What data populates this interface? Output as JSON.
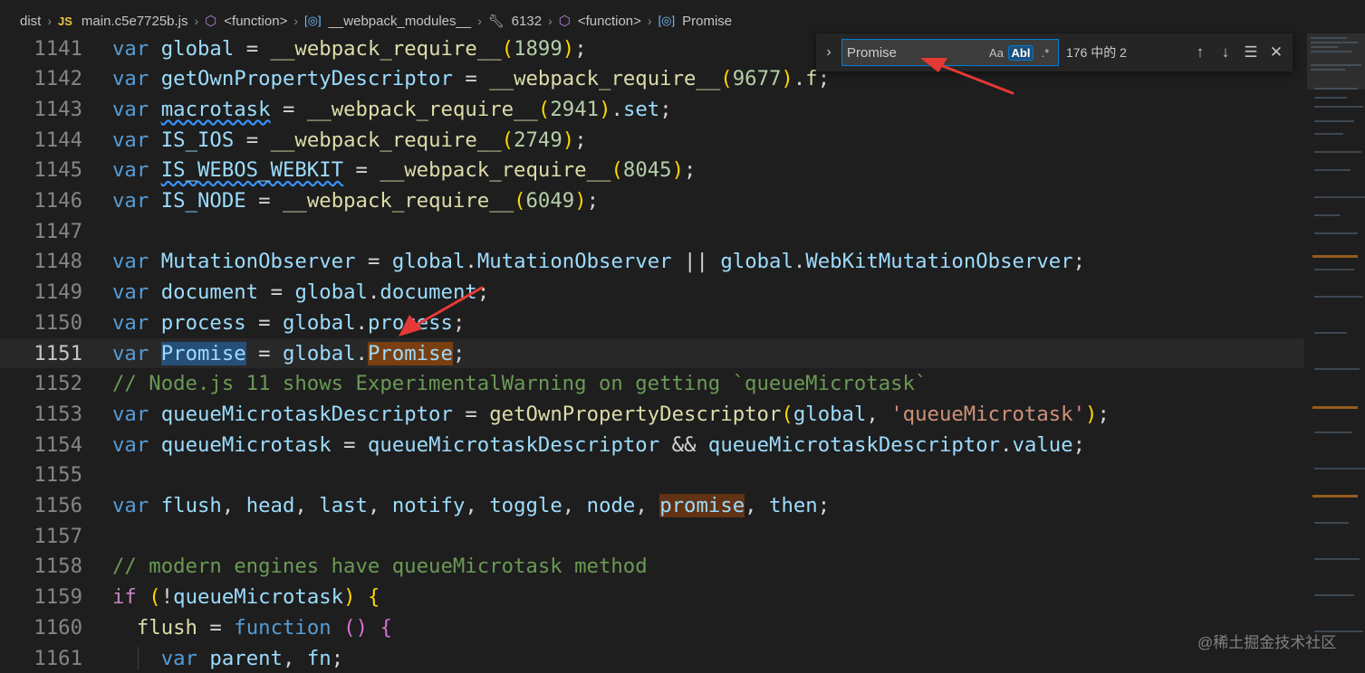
{
  "breadcrumb": {
    "items": [
      "dist",
      "main.c5e7725b.js",
      "<function>",
      "__webpack_modules__",
      "6132",
      "<function>",
      "Promise"
    ],
    "file_badge": "JS"
  },
  "find_widget": {
    "value": "Promise",
    "match_case_label": "Aa",
    "whole_word_label": "Abl",
    "regex_label": ".*",
    "result_count": "176 中的 2"
  },
  "editor": {
    "current_line": 1151,
    "lines": [
      {
        "n": "1141"
      },
      {
        "n": "1142"
      },
      {
        "n": "1143"
      },
      {
        "n": "1144"
      },
      {
        "n": "1145"
      },
      {
        "n": "1146"
      },
      {
        "n": "1147"
      },
      {
        "n": "1148"
      },
      {
        "n": "1149"
      },
      {
        "n": "1150"
      },
      {
        "n": "1151"
      },
      {
        "n": "1152"
      },
      {
        "n": "1153"
      },
      {
        "n": "1154"
      },
      {
        "n": "1155"
      },
      {
        "n": "1156"
      },
      {
        "n": "1157"
      },
      {
        "n": "1158"
      },
      {
        "n": "1159"
      },
      {
        "n": "1160"
      },
      {
        "n": "1161"
      }
    ],
    "code": {
      "kw_var": "var",
      "kw_if": "if",
      "kw_function": "function",
      "l1141": {
        "id": "global",
        "fn": "__webpack_require__",
        "num": "1899"
      },
      "l1142": {
        "id": "getOwnPropertyDescriptor",
        "fn": "__webpack_require__",
        "num": "9677",
        "prop": "f"
      },
      "l1143": {
        "id": "macrotask",
        "fn": "__webpack_require__",
        "num": "2941",
        "prop": "set"
      },
      "l1144": {
        "id": "IS_IOS",
        "fn": "__webpack_require__",
        "num": "2749"
      },
      "l1145": {
        "id": "IS_WEBOS_WEBKIT",
        "fn": "__webpack_require__",
        "num": "8045"
      },
      "l1146": {
        "id": "IS_NODE",
        "fn": "__webpack_require__",
        "num": "6049"
      },
      "l1148": {
        "id": "MutationObserver",
        "obj": "global",
        "p1": "MutationObserver",
        "p2": "WebKitMutationObserver"
      },
      "l1149": {
        "id": "document",
        "obj": "global",
        "prop": "document"
      },
      "l1150": {
        "id": "process",
        "obj": "global",
        "prop": "process"
      },
      "l1151": {
        "id": "Promise",
        "obj": "global",
        "prop": "Promise"
      },
      "l1152": {
        "comment": "// Node.js 11 shows ExperimentalWarning on getting `queueMicrotask`"
      },
      "l1153": {
        "id": "queueMicrotaskDescriptor",
        "fn": "getOwnPropertyDescriptor",
        "arg": "global",
        "str": "'queueMicrotask'"
      },
      "l1154": {
        "id": "queueMicrotask",
        "a": "queueMicrotaskDescriptor",
        "b": "queueMicrotaskDescriptor",
        "prop": "value"
      },
      "l1156": {
        "ids": [
          "flush",
          "head",
          "last",
          "notify",
          "toggle",
          "node"
        ],
        "match": "promise",
        "last": "then"
      },
      "l1158": {
        "comment": "// modern engines have queueMicrotask method"
      },
      "l1159": {
        "id": "queueMicrotask"
      },
      "l1160": {
        "id": "flush"
      },
      "l1161": {
        "a": "parent",
        "b": "fn"
      }
    }
  },
  "watermark": "@稀土掘金技术社区",
  "colors": {
    "background": "#1e1e1e",
    "keyword": "#569cd6",
    "variable": "#9cdcfe",
    "function": "#dcdcaa",
    "number": "#b5cea8",
    "string": "#ce9178",
    "comment": "#6a9955",
    "current_match": "#7a3f11",
    "selection": "#264f78",
    "arrow": "#e53935"
  }
}
